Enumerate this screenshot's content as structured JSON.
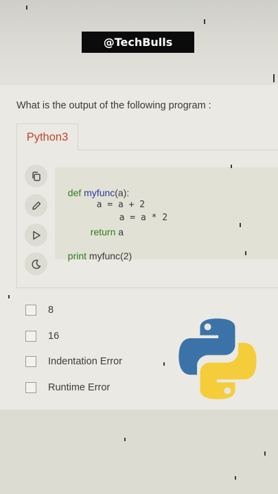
{
  "watermark": {
    "text": "@TechBulls"
  },
  "question": {
    "text": "What is the output of the following program :"
  },
  "editor": {
    "tab_label": "Python3",
    "toolbar": [
      "copy-icon",
      "edit-icon",
      "run-icon",
      "dark-mode-icon"
    ],
    "code": {
      "line1": {
        "kw": "def",
        "fn": "myfunc",
        "rest": "(a):"
      },
      "line2": {
        "text": "a = a + 2"
      },
      "line3": {
        "text": "a = a * 2"
      },
      "line4": {
        "kw": "return",
        "rest": "a"
      },
      "line5": {
        "kw": "print",
        "rest": "myfunc(2)"
      }
    }
  },
  "options": [
    {
      "label": "8"
    },
    {
      "label": "16"
    },
    {
      "label": "Indentation Error"
    },
    {
      "label": "Runtime Error"
    }
  ],
  "logo": {
    "name": "python-logo-icon",
    "colors": {
      "blue": "#3b73a8",
      "yellow": "#f5cd3a"
    }
  },
  "colors": {
    "tab_text": "#c0462e",
    "keyword": "#2f7a1f",
    "function": "#2c3aa0"
  }
}
